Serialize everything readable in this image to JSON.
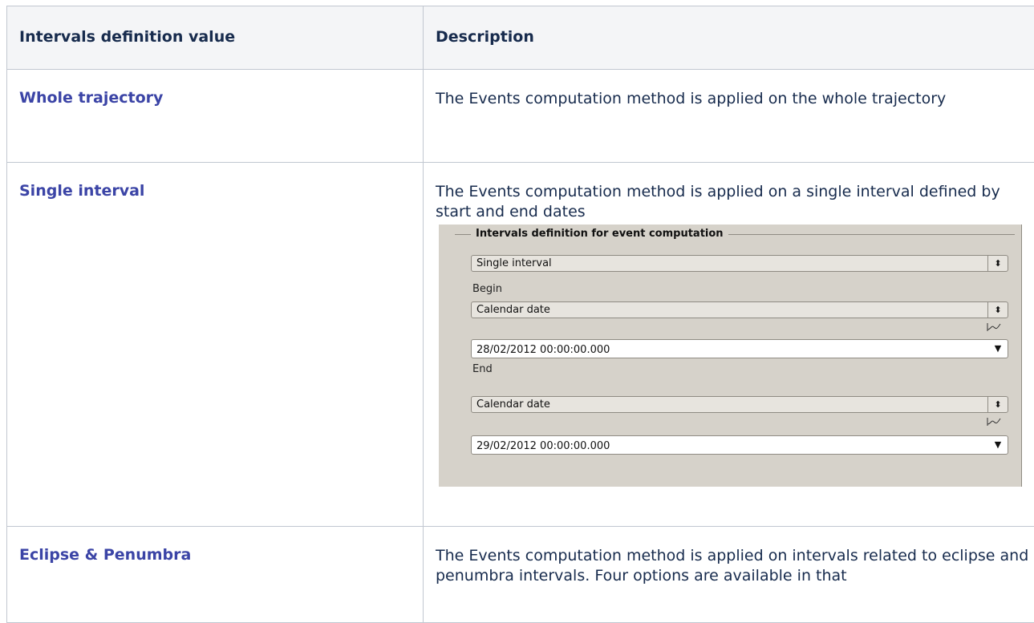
{
  "table": {
    "headers": [
      "Intervals definition value",
      "Description"
    ],
    "rows": [
      {
        "value": "Whole trajectory",
        "description": "The Events computation method is applied on the whole trajectory"
      },
      {
        "value": "Single interval",
        "description": "The Events computation method is applied on a single interval defined by start and end dates",
        "screenshot": {
          "group_title": "Intervals definition for event computation",
          "mode_select": "Single interval",
          "begin_label": "Begin",
          "begin_date_type": "Calendar date",
          "begin_date": "28/02/2012 00:00:00.000",
          "end_label": "End",
          "end_date_type": "Calendar date",
          "end_date": "29/02/2012 00:00:00.000",
          "icons": {
            "combo_arrows": "updown-arrows-icon",
            "dropdown": "chevron-down-icon",
            "curve": "curve-icon"
          }
        }
      },
      {
        "value": "Eclipse & Penumbra",
        "description": "The Events computation method is applied on intervals related to eclipse and penumbra intervals. Four options are available in that"
      }
    ]
  },
  "colors": {
    "link": "#3b44a6",
    "header_bg": "#f4f5f7",
    "border": "#c1c7d0",
    "widget_bg": "#d6d2ca"
  }
}
